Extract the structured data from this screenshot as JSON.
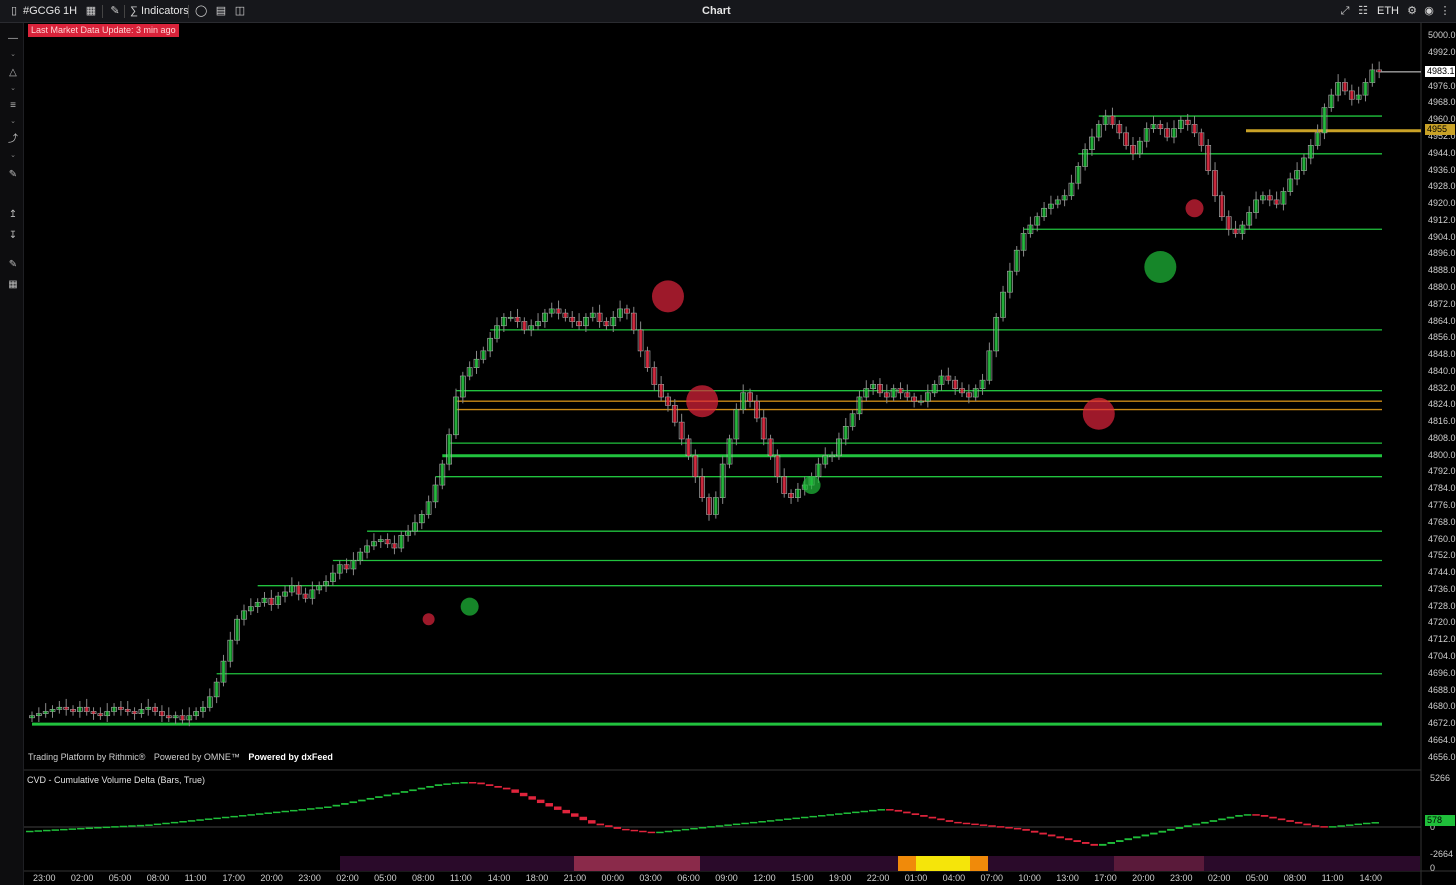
{
  "toolbar": {
    "symbol": "#GCG6",
    "interval": "1H",
    "indicators_label": "Indicators",
    "title": "Chart",
    "session": "ETH"
  },
  "alert": "Last Market Data Update: 3 min ago",
  "credits": {
    "rithmic": "Trading Platform by Rithmic®",
    "omne": "Powered by OMNE™",
    "dxfeed": "Powered by dxFeed"
  },
  "indicator_title": "CVD - Cumulative Volume Delta (Bars, True)",
  "colors": {
    "up": "#1fbf3a",
    "down": "#e0243c",
    "last_price_tag": "#ffffff",
    "highlight_tag": "#c9a227",
    "level_line": "#21c23e"
  },
  "price_axis": {
    "ticks": [
      "5000.0",
      "4992.0",
      "4976.0",
      "4968.0",
      "4960.0",
      "4952.0",
      "4944.0",
      "4936.0",
      "4928.0",
      "4920.0",
      "4912.0",
      "4904.0",
      "4896.0",
      "4888.0",
      "4880.0",
      "4872.0",
      "4864.0",
      "4856.0",
      "4848.0",
      "4840.0",
      "4832.0",
      "4824.0",
      "4816.0",
      "4808.0",
      "4800.0",
      "4792.0",
      "4784.0",
      "4776.0",
      "4768.0",
      "4760.0",
      "4752.0",
      "4744.0",
      "4736.0",
      "4728.0",
      "4720.0",
      "4712.0",
      "4704.0",
      "4696.0",
      "4688.0",
      "4680.0",
      "4672.0",
      "4664.0",
      "4656.0"
    ],
    "last_price": "4983.1",
    "highlight_price": "4955"
  },
  "cvd_axis": {
    "top": "5266",
    "zero": "0",
    "last": "578",
    "bottom": "-2664",
    "bottom_zero": "0"
  },
  "time_axis": [
    "23:00",
    "02:00",
    "05:00",
    "08:00",
    "11:00",
    "17:00",
    "20:00",
    "23:00",
    "02:00",
    "05:00",
    "08:00",
    "11:00",
    "14:00",
    "18:00",
    "21:00",
    "00:00",
    "03:00",
    "06:00",
    "09:00",
    "12:00",
    "15:00",
    "19:00",
    "22:00",
    "01:00",
    "04:00",
    "07:00",
    "10:00",
    "13:00",
    "17:00",
    "20:00",
    "23:00",
    "02:00",
    "05:00",
    "08:00",
    "11:00",
    "14:00"
  ],
  "chart_data": {
    "type": "candlestick",
    "symbol": "#GCG6",
    "interval": "1H",
    "ylim": [
      4652,
      5004
    ],
    "closes": [
      4676,
      4677,
      4678,
      4679,
      4680,
      4679,
      4678,
      4680,
      4678,
      4677,
      4676,
      4678,
      4680,
      4679,
      4678,
      4677,
      4679,
      4680,
      4678,
      4676,
      4675,
      4676,
      4674,
      4676,
      4678,
      4680,
      4685,
      4692,
      4702,
      4712,
      4722,
      4726,
      4728,
      4730,
      4732,
      4729,
      4733,
      4735,
      4738,
      4734,
      4732,
      4736,
      4738,
      4740,
      4744,
      4748,
      4746,
      4750,
      4754,
      4757,
      4759,
      4760,
      4758,
      4756,
      4762,
      4764,
      4768,
      4772,
      4778,
      4786,
      4796,
      4810,
      4828,
      4838,
      4842,
      4846,
      4850,
      4856,
      4862,
      4866,
      4866,
      4864,
      4860,
      4862,
      4864,
      4868,
      4870,
      4868,
      4866,
      4864,
      4862,
      4866,
      4868,
      4864,
      4862,
      4866,
      4870,
      4868,
      4860,
      4850,
      4842,
      4834,
      4828,
      4824,
      4816,
      4808,
      4800,
      4790,
      4780,
      4772,
      4780,
      4796,
      4808,
      4822,
      4830,
      4826,
      4818,
      4808,
      4800,
      4790,
      4782,
      4780,
      4784,
      4786,
      4790,
      4796,
      4800,
      4800,
      4808,
      4814,
      4820,
      4828,
      4832,
      4834,
      4830,
      4828,
      4832,
      4830,
      4828,
      4826,
      4826,
      4830,
      4834,
      4838,
      4836,
      4832,
      4830,
      4828,
      4832,
      4836,
      4850,
      4866,
      4878,
      4888,
      4898,
      4906,
      4910,
      4914,
      4918,
      4920,
      4922,
      4924,
      4930,
      4938,
      4946,
      4952,
      4958,
      4962,
      4958,
      4954,
      4948,
      4944,
      4950,
      4956,
      4958,
      4956,
      4952,
      4956,
      4960,
      4958,
      4954,
      4948,
      4936,
      4924,
      4914,
      4908,
      4906,
      4910,
      4916,
      4922,
      4924,
      4922,
      4920,
      4926,
      4932,
      4936,
      4942,
      4948,
      4954,
      4966,
      4972,
      4978,
      4974,
      4970,
      4972,
      4978,
      4984,
      4983.1
    ],
    "volume_bubbles": [
      {
        "x": 58,
        "price": 4722,
        "side": "sell",
        "size": "small"
      },
      {
        "x": 64,
        "price": 4728,
        "side": "buy",
        "size": "medium"
      },
      {
        "x": 93,
        "price": 4876,
        "side": "sell",
        "size": "large"
      },
      {
        "x": 98,
        "price": 4826,
        "side": "sell",
        "size": "large"
      },
      {
        "x": 114,
        "price": 4786,
        "side": "buy",
        "size": "medium"
      },
      {
        "x": 156,
        "price": 4820,
        "side": "sell",
        "size": "large"
      },
      {
        "x": 165,
        "price": 4890,
        "side": "buy",
        "size": "large"
      },
      {
        "x": 170,
        "price": 4918,
        "side": "sell",
        "size": "medium"
      }
    ],
    "levels": [
      4672,
      4696,
      4738,
      4750,
      4764,
      4790,
      4800,
      4806,
      4822,
      4826,
      4831,
      4860,
      4908,
      4944,
      4962
    ],
    "cvd": [
      -400,
      -350,
      -300,
      -250,
      -200,
      -150,
      -100,
      -50,
      0,
      50,
      100,
      150,
      200,
      250,
      300,
      400,
      500,
      600,
      700,
      800,
      900,
      1000,
      1100,
      1200,
      1300,
      1400,
      1500,
      1600,
      1700,
      1800,
      1900,
      2000,
      2100,
      2200,
      2300,
      2400,
      2600,
      2800,
      3000,
      3200,
      3400,
      3600,
      3800,
      4000,
      4200,
      4400,
      4600,
      4800,
      5000,
      5100,
      5200,
      5266,
      5200,
      5000,
      4800,
      4600,
      4400,
      4000,
      3600,
      3200,
      2800,
      2400,
      2000,
      1600,
      1200,
      800,
      400,
      200,
      0,
      -200,
      -300,
      -400,
      -500,
      -600,
      -500,
      -400,
      -300,
      -200,
      -100,
      0,
      100,
      200,
      300,
      400,
      500,
      600,
      700,
      800,
      900,
      1000,
      1100,
      1200,
      1300,
      1400,
      1500,
      1600,
      1700,
      1800,
      1900,
      2000,
      2100,
      2000,
      1800,
      1600,
      1400,
      1200,
      1000,
      800,
      600,
      500,
      400,
      300,
      200,
      100,
      0,
      -100,
      -200,
      -400,
      -600,
      -800,
      -1000,
      -1200,
      -1400,
      -1600,
      -1800,
      -2000,
      -1800,
      -1600,
      -1400,
      -1200,
      -1000,
      -800,
      -600,
      -400,
      -200,
      0,
      200,
      400,
      600,
      800,
      1000,
      1200,
      1400,
      1500,
      1400,
      1200,
      1000,
      800,
      600,
      400,
      200,
      100,
      0,
      100,
      200,
      300,
      400,
      500,
      578
    ]
  }
}
